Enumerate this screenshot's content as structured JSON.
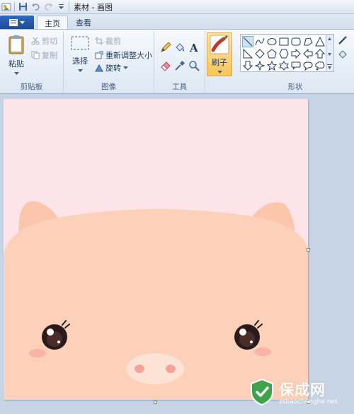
{
  "window": {
    "title": "素材 - 画图"
  },
  "tabs": [
    {
      "label": "主页",
      "active": true
    },
    {
      "label": "查看",
      "active": false
    }
  ],
  "ribbon": {
    "clipboard": {
      "paste_label": "粘贴",
      "cut_label": "剪切",
      "copy_label": "复制",
      "group_label": "剪贴板"
    },
    "image": {
      "select_label": "选择",
      "crop_label": "裁剪",
      "resize_label": "重新调整大小",
      "rotate_label": "旋转",
      "group_label": "图像"
    },
    "tools": {
      "group_label": "工具"
    },
    "brush": {
      "label": "刷子"
    },
    "shapes": {
      "group_label": "形状",
      "selected": "line"
    }
  },
  "watermark": {
    "title": "保成网",
    "url": "zsbaochenghe.net"
  },
  "colors": {
    "canvas_bg": "#fde4e9",
    "pig_face": "#fdd0b9",
    "accent_blue": "#1c4a91",
    "brush_highlight": "#f7c65a"
  }
}
